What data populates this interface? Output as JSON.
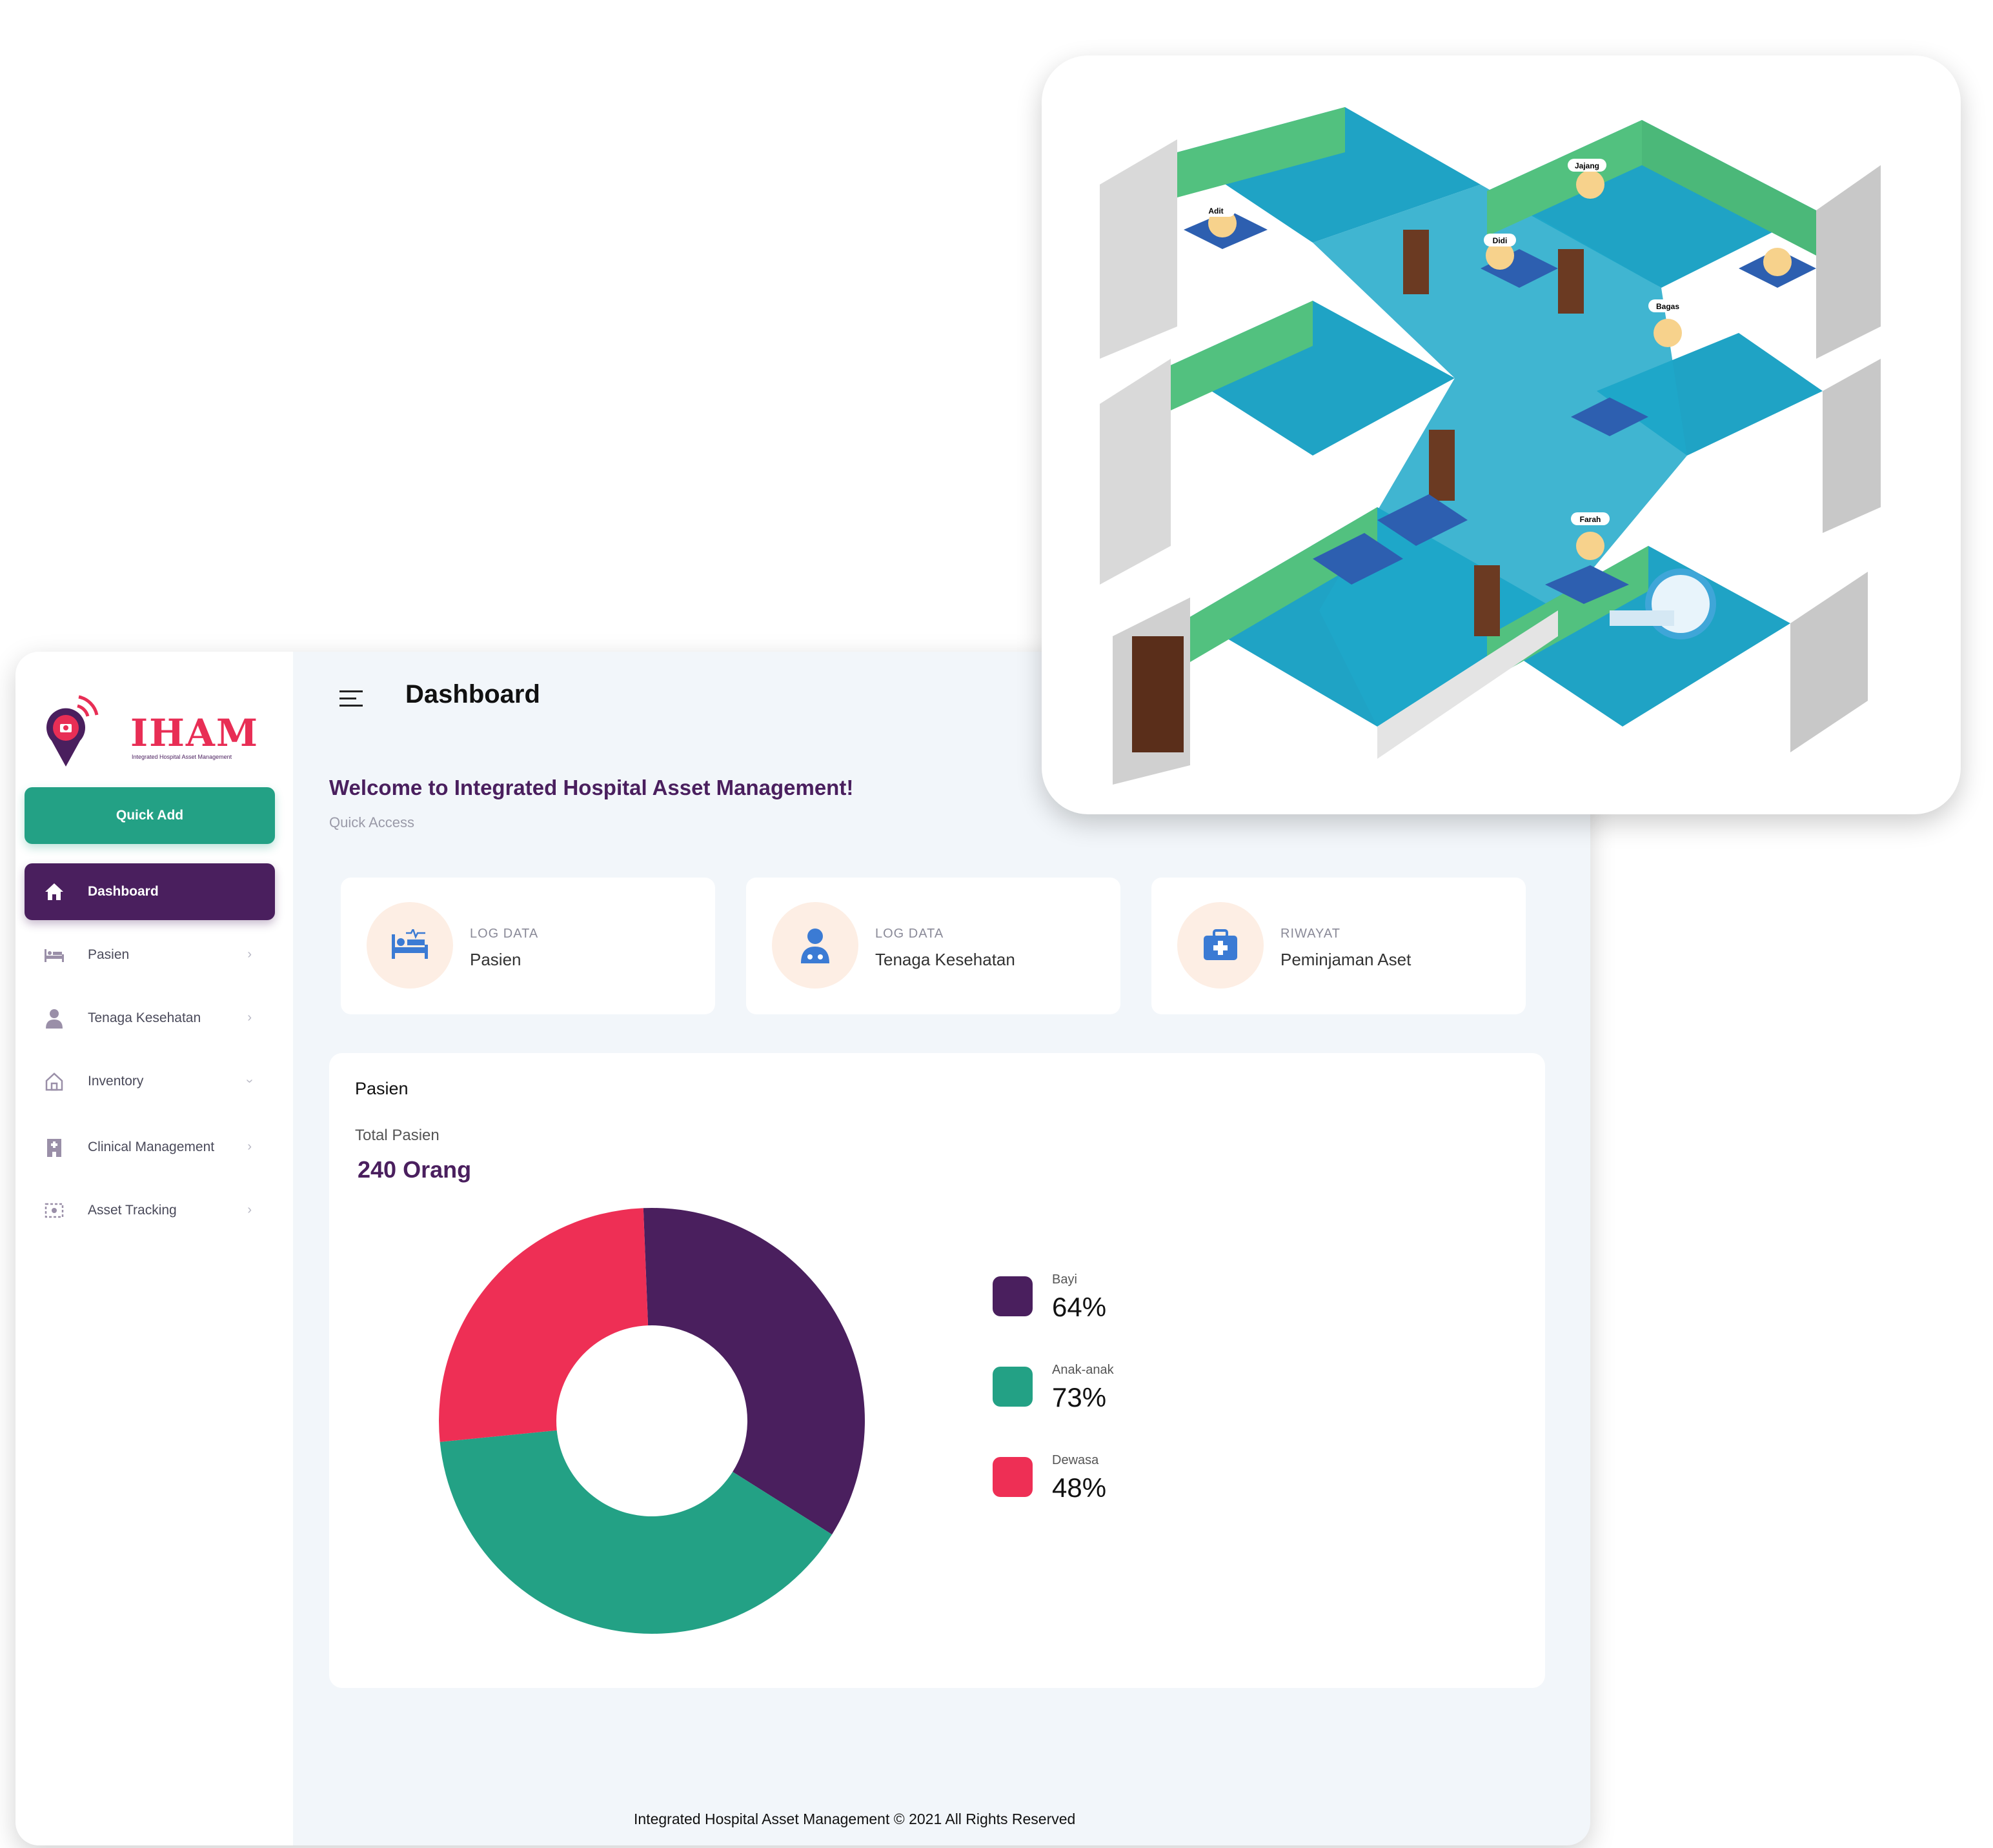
{
  "sidebar": {
    "logo_text": "IHAM",
    "logo_subtitle": "Integrated Hospital Asset Management",
    "quick_add_label": "Quick Add",
    "items": [
      {
        "label": "Dashboard",
        "icon": "home-icon",
        "active": true
      },
      {
        "label": "Pasien",
        "icon": "bed-icon"
      },
      {
        "label": "Tenaga Kesehatan",
        "icon": "doctor-icon"
      },
      {
        "label": "Inventory",
        "icon": "house-icon",
        "expanded": true
      },
      {
        "label": "Clinical Management",
        "icon": "building-icon"
      },
      {
        "label": "Asset Tracking",
        "icon": "tracking-icon"
      }
    ]
  },
  "header": {
    "title": "Dashboard"
  },
  "main": {
    "welcome": "Welcome to Integrated Hospital Asset Management!",
    "quick_access_label": "Quick Access",
    "cards": [
      {
        "kicker": "LOG DATA",
        "title": "Pasien",
        "icon": "bed-icon"
      },
      {
        "kicker": "LOG DATA",
        "title": "Tenaga Kesehatan",
        "icon": "doctor-icon"
      },
      {
        "kicker": "RIWAYAT",
        "title": "Peminjaman Aset",
        "icon": "medical-kit-icon"
      }
    ],
    "panel": {
      "title": "Pasien",
      "total_label": "Total Pasien",
      "total_value": "240 Orang"
    }
  },
  "chart_data": {
    "type": "pie",
    "categories": [
      "Bayi",
      "Anak-anak",
      "Dewasa"
    ],
    "values": [
      64,
      73,
      48
    ],
    "value_labels": [
      "64%",
      "73%",
      "48%"
    ],
    "colors": [
      "#4a1f5e",
      "#23a185",
      "#ee2f55"
    ],
    "donut": true,
    "legend": "right"
  },
  "illustration": {
    "name_tags": [
      "Adit",
      "Jajang",
      "Didi",
      "Bagas",
      "Farah"
    ]
  },
  "footer": {
    "text": "Integrated Hospital Asset Management © 2021 All Rights Reserved"
  },
  "colors": {
    "primary": "#4a1f5e",
    "accent": "#23a185",
    "brand_red": "#e82e55",
    "background": "#f2f6fa"
  }
}
